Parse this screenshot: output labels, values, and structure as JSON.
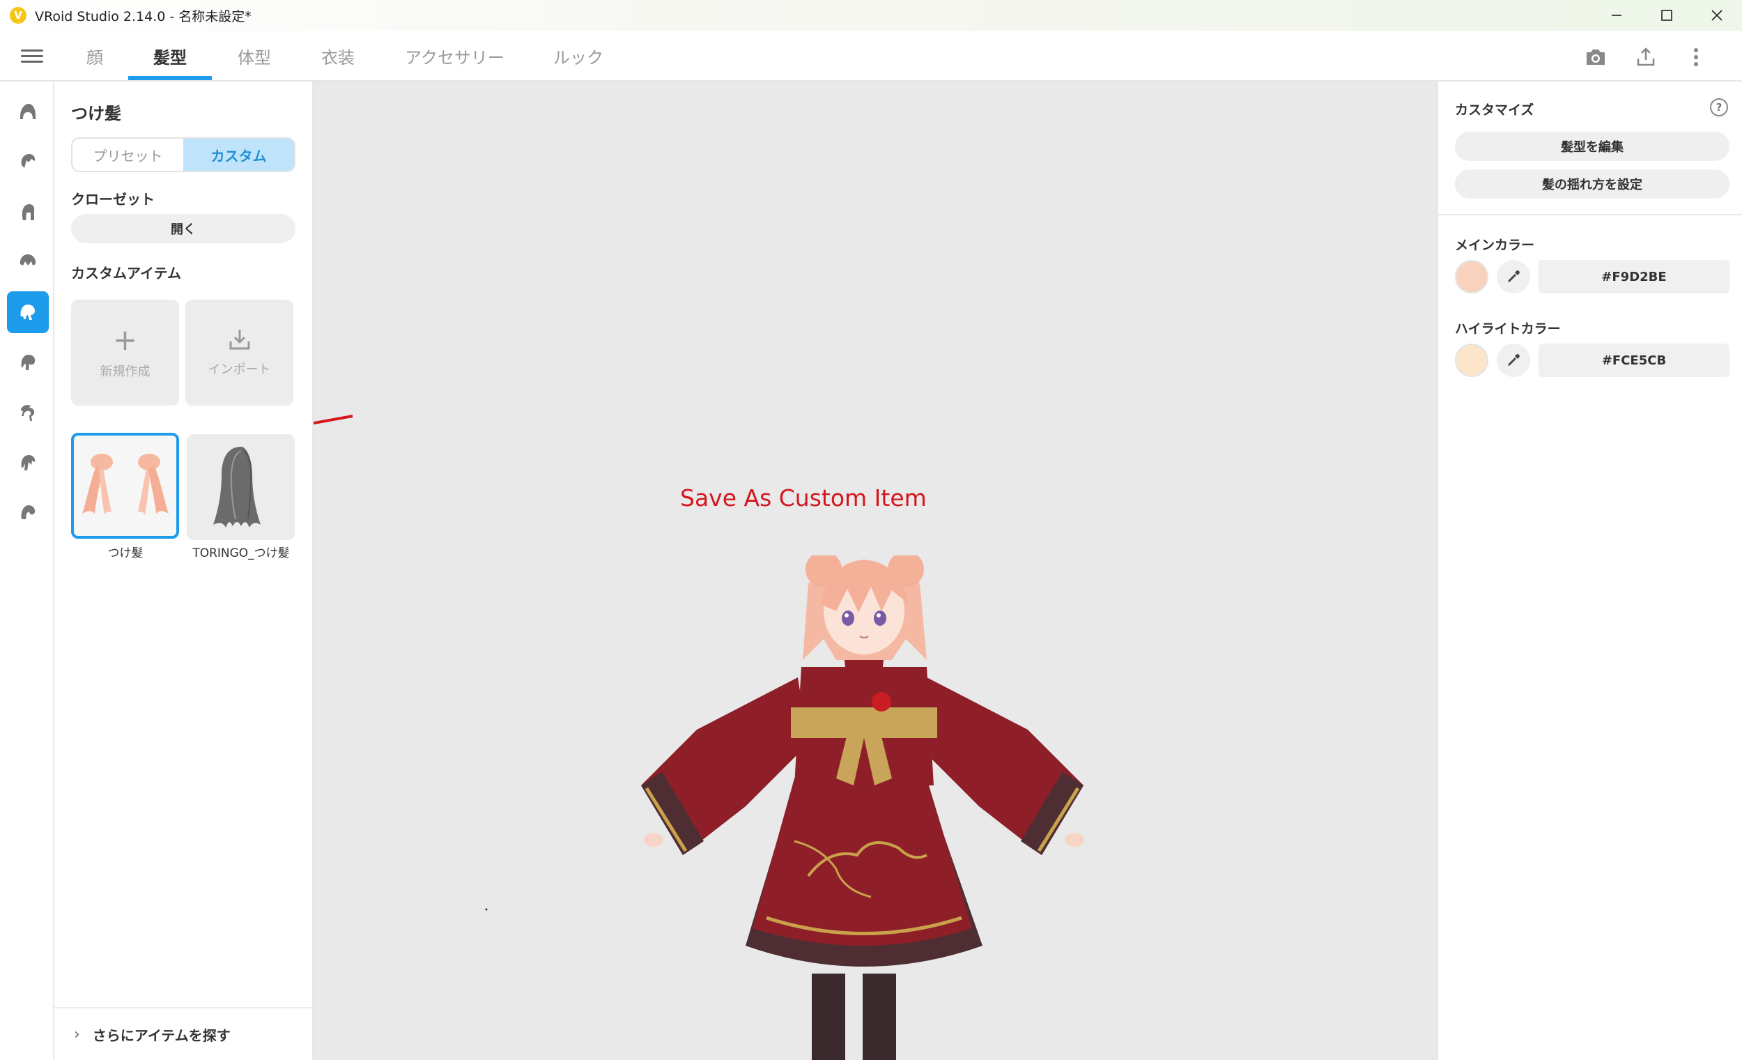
{
  "window": {
    "title": "VRoid Studio 2.14.0 - 名称未設定*",
    "logo_glyph": "V"
  },
  "nav": {
    "tabs": [
      {
        "label": "顔"
      },
      {
        "label": "髪型"
      },
      {
        "label": "体型"
      },
      {
        "label": "衣装"
      },
      {
        "label": "アクセサリー"
      },
      {
        "label": "ルック"
      }
    ],
    "active_tab": "髪型"
  },
  "left_panel": {
    "title": "つけ髪",
    "segments": [
      "プリセット",
      "カスタム"
    ],
    "active_segment": "カスタム",
    "closet_label": "クローゼット",
    "open_button": "開く",
    "custom_items_label": "カスタムアイテム",
    "new_label": "新規作成",
    "import_label": "インポート",
    "items": [
      {
        "label": "つけ髪"
      },
      {
        "label": "TORINGO_つけ髪"
      }
    ],
    "more_items": "さらにアイテムを探す"
  },
  "viewport": {
    "annotation": "Save As Custom Item"
  },
  "right_panel": {
    "title": "カスタマイズ",
    "edit_hair": "髪型を編集",
    "sway_settings": "髪の揺れ方を設定",
    "main_color_label": "メインカラー",
    "main_color_hex": "#F9D2BE",
    "highlight_color_label": "ハイライトカラー",
    "highlight_color_hex": "#FCE5CB"
  },
  "colors": {
    "accent": "#1e9bea",
    "annotation": "#d4161e",
    "viewport_bg": "#e9e9e9"
  },
  "icons": {
    "rail": [
      "hair-base-icon",
      "front-hair-icon",
      "back-hair-icon",
      "side-hair-icon",
      "extension-hair-icon",
      "ahoge-icon",
      "ponytail-icon",
      "bangs-icon",
      "other-hair-icon"
    ]
  }
}
